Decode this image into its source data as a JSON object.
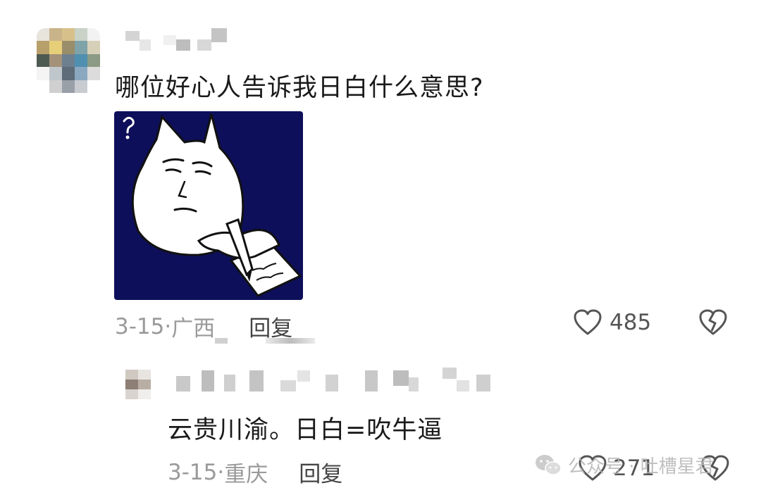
{
  "comment": {
    "text": "哪位好心人告诉我日白什么意思?",
    "date": "3-15",
    "separator": "·",
    "location": "广西",
    "reply_label": "回复",
    "like_count": "485"
  },
  "reply_comment": {
    "text": "云贵川渝。日白=吹牛逼",
    "date": "3-15",
    "separator": "·",
    "location": "重庆",
    "reply_label": "回复",
    "like_count": "271"
  },
  "watermark": {
    "text": "公众号 · 吐槽星君",
    "icon": "wechat-icon"
  },
  "colors": {
    "sticker_bg": "#0d0f5a",
    "meta_text": "#9a9a9a"
  }
}
